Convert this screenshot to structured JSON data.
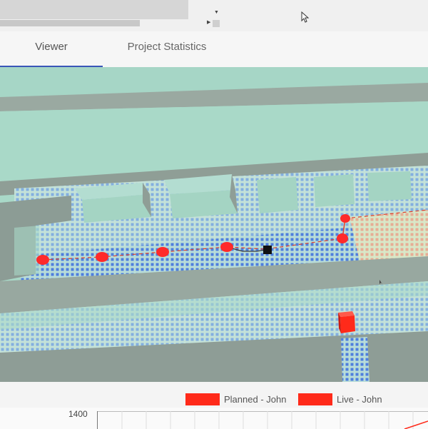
{
  "tabs": [
    {
      "label": "Viewer",
      "active": true
    },
    {
      "label": "Project Statistics",
      "active": false
    }
  ],
  "legend": [
    {
      "label": "Planned - John",
      "color": "#ff2a1a"
    },
    {
      "label": "Live - John",
      "color": "#ff2a1a"
    }
  ],
  "chart": {
    "y_tick": "1400"
  },
  "colors": {
    "accent": "#3a56b8",
    "route_marker": "#ff2a2a",
    "ground": "#a9d9c8",
    "coverage_dots": "#2f62e0"
  }
}
